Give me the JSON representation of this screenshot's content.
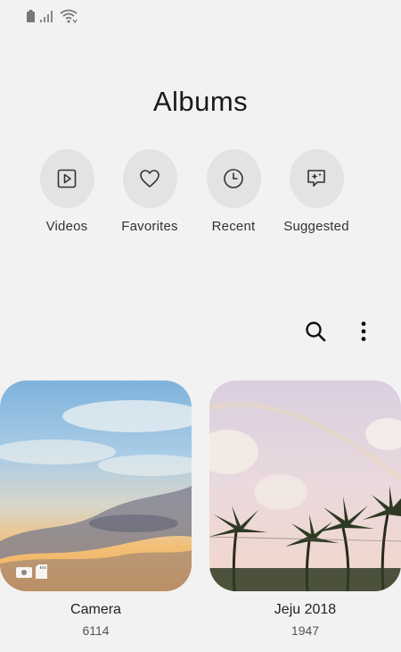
{
  "header": {
    "title": "Albums"
  },
  "quick_access": [
    {
      "label": "Videos",
      "icon": "video-icon"
    },
    {
      "label": "Favorites",
      "icon": "heart-icon"
    },
    {
      "label": "Recent",
      "icon": "clock-icon"
    },
    {
      "label": "Suggested",
      "icon": "sparkle-chat-icon"
    }
  ],
  "toolbar": {
    "search_icon": "search-icon",
    "more_icon": "more-options-icon"
  },
  "albums": [
    {
      "name": "Camera",
      "count": "6114"
    },
    {
      "name": "Jeju 2018",
      "count": "1947"
    }
  ],
  "colors": {
    "background": "#f2f2f2",
    "circle": "#e3e3e3"
  }
}
